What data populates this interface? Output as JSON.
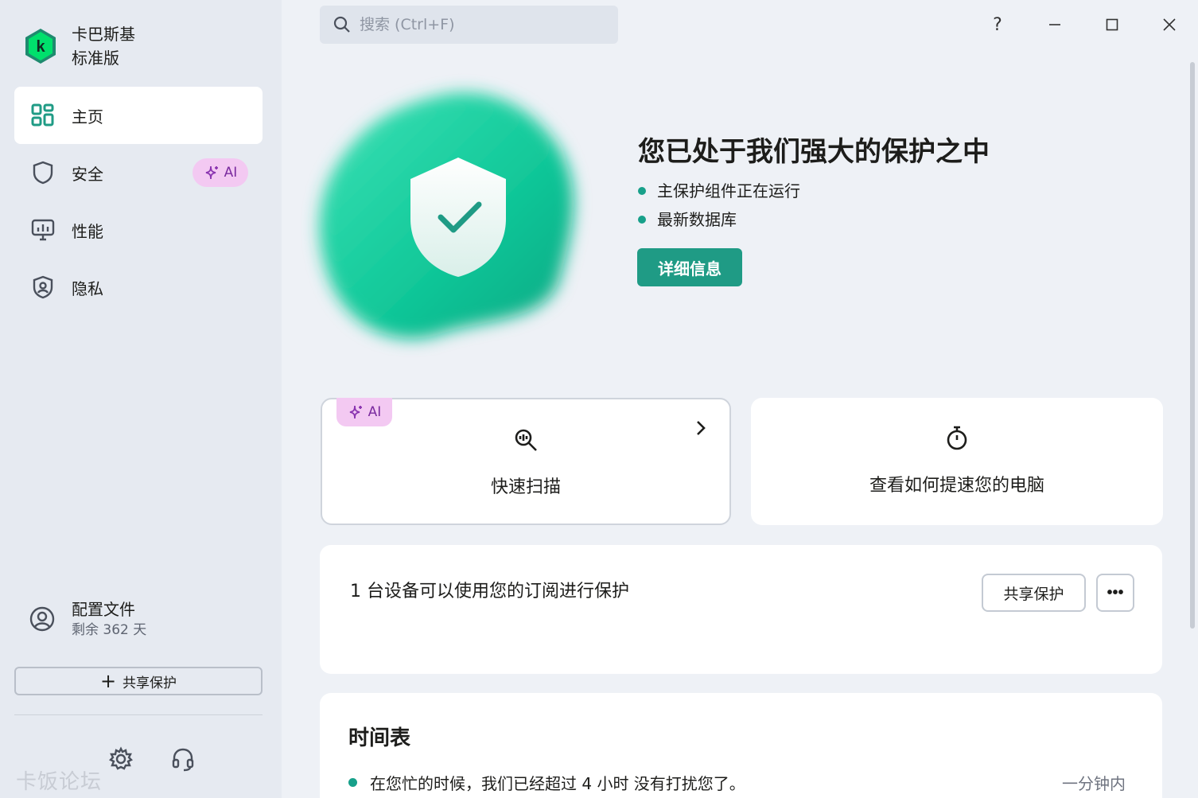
{
  "brand": {
    "line1": "卡巴斯基",
    "line2": "标准版"
  },
  "sidebar": {
    "items": [
      {
        "label": "主页",
        "icon": "grid-icon"
      },
      {
        "label": "安全",
        "icon": "shield-icon",
        "badge": "AI"
      },
      {
        "label": "性能",
        "icon": "monitor-icon"
      },
      {
        "label": "隐私",
        "icon": "privacy-shield-icon"
      }
    ],
    "profile": {
      "title": "配置文件",
      "subtitle": "剩余 362 天"
    },
    "share_button": "共享保护",
    "watermark": "卡饭论坛"
  },
  "search": {
    "placeholder": "搜索 (Ctrl+F)"
  },
  "window": {
    "help": "?"
  },
  "hero": {
    "title": "您已处于我们强大的保护之中",
    "bullets": [
      "主保护组件正在运行",
      "最新数据库"
    ],
    "details_button": "详细信息"
  },
  "cards": {
    "scan": {
      "badge": "AI",
      "label": "快速扫描"
    },
    "speed": {
      "label": "查看如何提速您的电脑"
    }
  },
  "subscription": {
    "text": "1 台设备可以使用您的订阅进行保护",
    "share_button": "共享保护",
    "more_button": "•••"
  },
  "timeline": {
    "title": "时间表",
    "entries": [
      {
        "text": "在您忙的时候，我们已经超过 4 小时 没有打扰您了。",
        "when": "一分钟内"
      }
    ]
  },
  "colors": {
    "accent": "#1f9b85",
    "ai_badge": "#f3c9f2",
    "sidebar_bg": "#e6eaf1"
  }
}
